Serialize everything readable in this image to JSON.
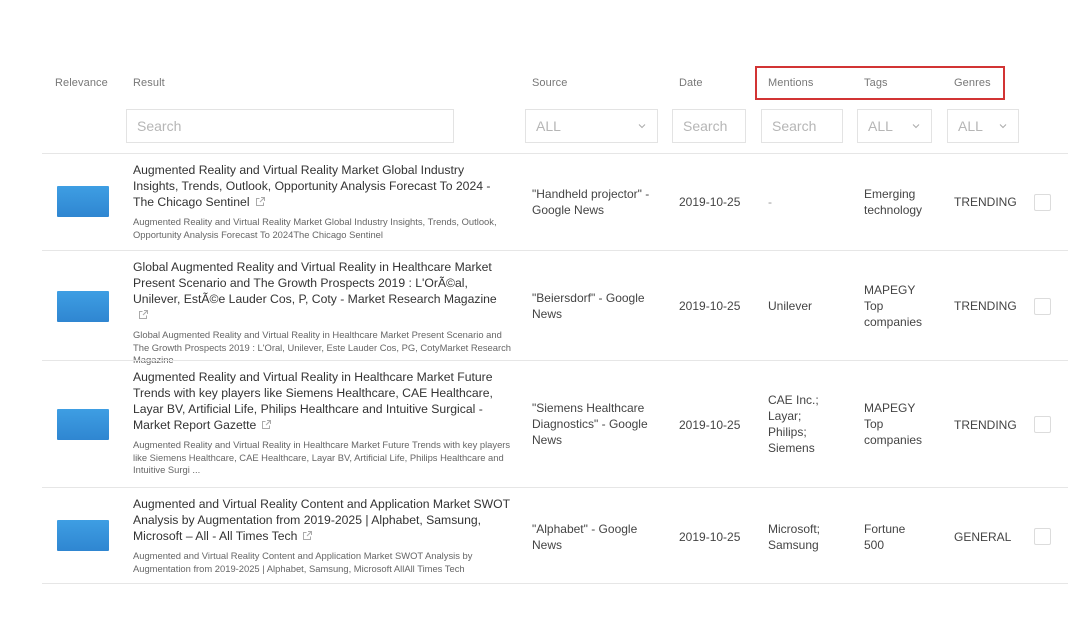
{
  "columns": {
    "relevance": "Relevance",
    "result": "Result",
    "source": "Source",
    "date": "Date",
    "mentions": "Mentions",
    "tags": "Tags",
    "genres": "Genres"
  },
  "filters": {
    "result_placeholder": "Search",
    "source_value": "ALL",
    "date_placeholder": "Search",
    "mentions_placeholder": "Search",
    "tags_value": "ALL",
    "genres_value": "ALL"
  },
  "rows": [
    {
      "title": "Augmented Reality and Virtual Reality Market Global Industry Insights, Trends, Outlook, Opportunity Analysis Forecast To 2024 - The Chicago Sentinel",
      "snippet": "Augmented Reality and Virtual Reality Market Global Industry Insights, Trends, Outlook, Opportunity Analysis Forecast To 2024The Chicago Sentinel",
      "source": "\"Handheld projector\" - Google News",
      "date": "2019-10-25",
      "mentions": "-",
      "tags": "Emerging technology",
      "genres": "TRENDING"
    },
    {
      "title": "Global Augmented Reality and Virtual Reality in Healthcare Market Present Scenario and The Growth Prospects 2019 : L'OrÃ©al, Unilever, EstÃ©e Lauder Cos, P, Coty - Market Research Magazine",
      "snippet": "Global Augmented Reality and Virtual Reality in Healthcare Market Present Scenario and The Growth Prospects 2019 : L'Oral, Unilever, Este Lauder Cos, PG, CotyMarket Research Magazine",
      "source": "\"Beiersdorf\" - Google News",
      "date": "2019-10-25",
      "mentions": "Unilever",
      "tags": "MAPEGY Top companies",
      "genres": "TRENDING"
    },
    {
      "title": "Augmented Reality and Virtual Reality in Healthcare Market Future Trends with key players like Siemens Healthcare, CAE Healthcare, Layar BV, Artificial Life, Philips Healthcare and Intuitive Surgical - Market Report Gazette",
      "snippet": "Augmented Reality and Virtual Reality in Healthcare Market Future Trends with key players like Siemens Healthcare, CAE Healthcare, Layar BV, Artificial Life, Philips Healthcare and Intuitive Surgi ...",
      "source": "\"Siemens Healthcare Diagnostics\" - Google News",
      "date": "2019-10-25",
      "mentions": "CAE Inc.; Layar; Philips; Siemens",
      "tags": "MAPEGY Top companies",
      "genres": "TRENDING"
    },
    {
      "title": "Augmented and Virtual Reality Content and Application Market SWOT Analysis by Augmentation from 2019-2025 | Alphabet, Samsung, Microsoft – All - All Times Tech",
      "snippet": "Augmented and Virtual Reality Content and Application Market SWOT Analysis by Augmentation from 2019-2025 | Alphabet, Samsung, Microsoft AllAll Times Tech",
      "source": "\"Alphabet\" - Google News",
      "date": "2019-10-25",
      "mentions": "Microsoft; Samsung",
      "tags": "Fortune 500",
      "genres": "GENERAL"
    }
  ]
}
